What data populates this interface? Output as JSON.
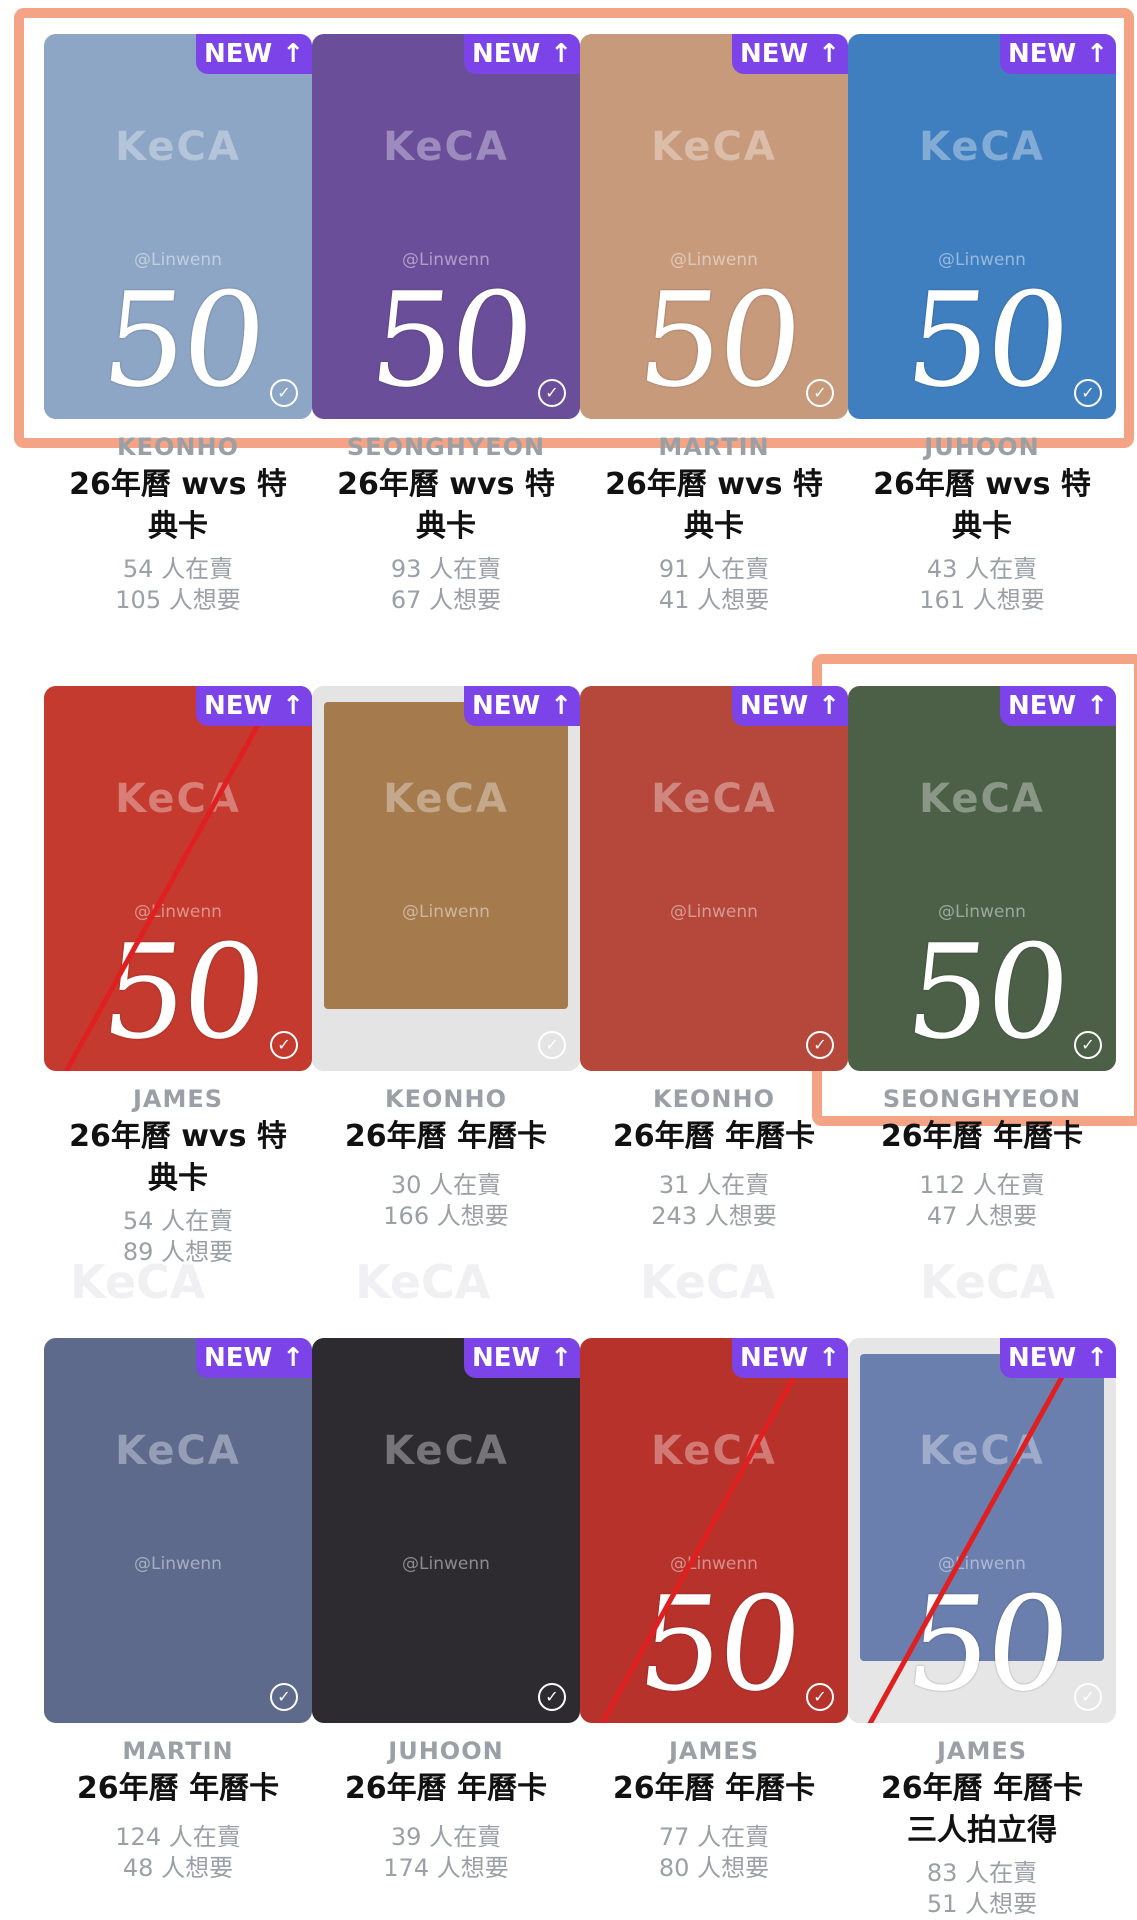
{
  "badge_label": "NEW",
  "badge_arrow": "↑",
  "price_mark": "50",
  "watermark": "KeCA",
  "handle": "@Linwenn",
  "cards": [
    {
      "member": "KEONHO",
      "title_l1": "26年曆 wvs 特",
      "title_l2": "典卡",
      "selling": "54 人在賣",
      "wanting": "105 人想要",
      "bg": "#8da6c6",
      "price": true,
      "crossed": false
    },
    {
      "member": "SEONGHYEON",
      "title_l1": "26年曆 wvs 特",
      "title_l2": "典卡",
      "selling": "93 人在賣",
      "wanting": "67 人想要",
      "bg": "#6b4e9a",
      "price": true,
      "crossed": false
    },
    {
      "member": "MARTIN",
      "title_l1": "26年曆 wvs 特",
      "title_l2": "典卡",
      "selling": "91 人在賣",
      "wanting": "41 人想要",
      "bg": "#c89a7c",
      "price": true,
      "crossed": false
    },
    {
      "member": "JUHOON",
      "title_l1": "26年曆 wvs 特",
      "title_l2": "典卡",
      "selling": "43 人在賣",
      "wanting": "161 人想要",
      "bg": "#3f7fc0",
      "price": true,
      "crossed": false
    },
    {
      "member": "JAMES",
      "title_l1": "26年曆 wvs 特",
      "title_l2": "典卡",
      "selling": "54 人在賣",
      "wanting": "89 人想要",
      "bg": "#c43a2e",
      "price": true,
      "crossed": true
    },
    {
      "member": "KEONHO",
      "title_l1": "26年曆 年曆卡",
      "title_l2": "",
      "selling": "30 人在賣",
      "wanting": "166 人想要",
      "bg": "#e4e4e4",
      "polaroid": "#a57a4d",
      "price": false,
      "crossed": false
    },
    {
      "member": "KEONHO",
      "title_l1": "26年曆 年曆卡",
      "title_l2": "",
      "selling": "31 人在賣",
      "wanting": "243 人想要",
      "bg": "#b5473b",
      "price": false,
      "crossed": false
    },
    {
      "member": "SEONGHYEON",
      "title_l1": "26年曆 年曆卡",
      "title_l2": "",
      "selling": "112 人在賣",
      "wanting": "47 人想要",
      "bg": "#4c6048",
      "price": true,
      "crossed": false
    },
    {
      "member": "MARTIN",
      "title_l1": "26年曆 年曆卡",
      "title_l2": "",
      "selling": "124 人在賣",
      "wanting": "48 人想要",
      "bg": "#5d6a8c",
      "price": false,
      "crossed": false
    },
    {
      "member": "JUHOON",
      "title_l1": "26年曆 年曆卡",
      "title_l2": "",
      "selling": "39 人在賣",
      "wanting": "174 人想要",
      "bg": "#2d2a30",
      "price": false,
      "crossed": false
    },
    {
      "member": "JAMES",
      "title_l1": "26年曆 年曆卡",
      "title_l2": "",
      "selling": "77 人在賣",
      "wanting": "80 人想要",
      "bg": "#b8322c",
      "price": true,
      "crossed": true
    },
    {
      "member": "JAMES",
      "title_l1": "26年曆 年曆卡",
      "title_l2": "三人拍立得",
      "selling": "83 人在賣",
      "wanting": "51 人想要",
      "bg": "#e6e6e6",
      "polaroid": "#6a7fae",
      "price": true,
      "crossed": true
    }
  ],
  "colors": {
    "badge": "#7b43e8",
    "highlight": "#f4a484",
    "strike": "#e02020"
  }
}
